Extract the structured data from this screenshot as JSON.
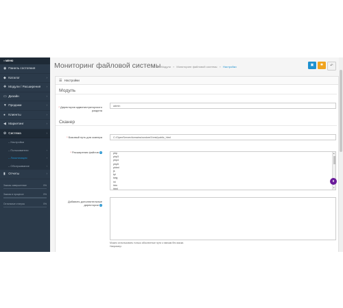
{
  "sidebar": {
    "header": "МЕНЮ",
    "items": [
      {
        "icon": "dashboard-icon",
        "glyph": "◉",
        "label": "Панель состояния",
        "chevron": ""
      },
      {
        "icon": "tag-icon",
        "glyph": "◆",
        "label": "Каталог",
        "chevron": "›"
      },
      {
        "icon": "puzzle-icon",
        "glyph": "✚",
        "label": "Модули / Расширения",
        "chevron": "›"
      },
      {
        "icon": "monitor-icon",
        "glyph": "▭",
        "label": "Дизайн",
        "chevron": "›"
      },
      {
        "icon": "cart-icon",
        "glyph": "▼",
        "label": "Продажи",
        "chevron": "›"
      },
      {
        "icon": "user-icon",
        "glyph": "●",
        "label": "Клиенты",
        "chevron": "›"
      },
      {
        "icon": "share-icon",
        "glyph": "◀",
        "label": "Маркетинг",
        "chevron": "›"
      },
      {
        "icon": "gear-icon",
        "glyph": "✿",
        "label": "Система",
        "chevron": "›"
      }
    ],
    "subitems": [
      {
        "label": "Настройки",
        "chevron": ""
      },
      {
        "label": "Пользователи",
        "chevron": "›"
      },
      {
        "label": "Локализация",
        "chevron": "›"
      },
      {
        "label": "Обслуживание",
        "chevron": "›"
      }
    ],
    "reports": {
      "icon": "chart-icon",
      "glyph": "▮",
      "label": "Отчеты",
      "chevron": "›"
    },
    "stats": [
      {
        "label": "Заказы завершенные",
        "value": "0%",
        "fraction": 0
      },
      {
        "label": "Заказы в процессе",
        "value": "0%",
        "fraction": 0
      },
      {
        "label": "Остальные статусы",
        "value": "0%",
        "fraction": 0
      }
    ]
  },
  "header": {
    "title": "Мониторинг файловой системы",
    "breadcrumbs": {
      "home_icon": "⌂",
      "sep": "»",
      "modules": "Модули",
      "page": "Мониторинг файловой системы",
      "current": "Настройки"
    },
    "buttons": {
      "save": "▣",
      "gear": "✱",
      "back": "↶"
    }
  },
  "panel": {
    "heading": "Настройки",
    "heading_icon": "☰",
    "module_legend": "Модуль",
    "scanner_legend": "Сканер",
    "admin_dir": {
      "label": "Директория администраторского раздела",
      "value": "admin"
    },
    "base_path": {
      "label": "Базовый путь для сканера",
      "value": "C:/OpenServer/domains/ocstore3.test/public_html"
    },
    "extensions": {
      "label": "Расширения файлов",
      "options": [
        "php",
        "php3",
        "php4",
        "php5",
        "phtml",
        "js",
        "tpl",
        "twig",
        "ini",
        "htm",
        "html"
      ]
    },
    "extra_dirs": {
      "label": "Добавить дополнительные директории",
      "value": ""
    },
    "hint": [
      "Можно использовать только абсолютные пути к папкам без маски.",
      "Например:"
    ]
  },
  "fab": {
    "label": "0"
  }
}
